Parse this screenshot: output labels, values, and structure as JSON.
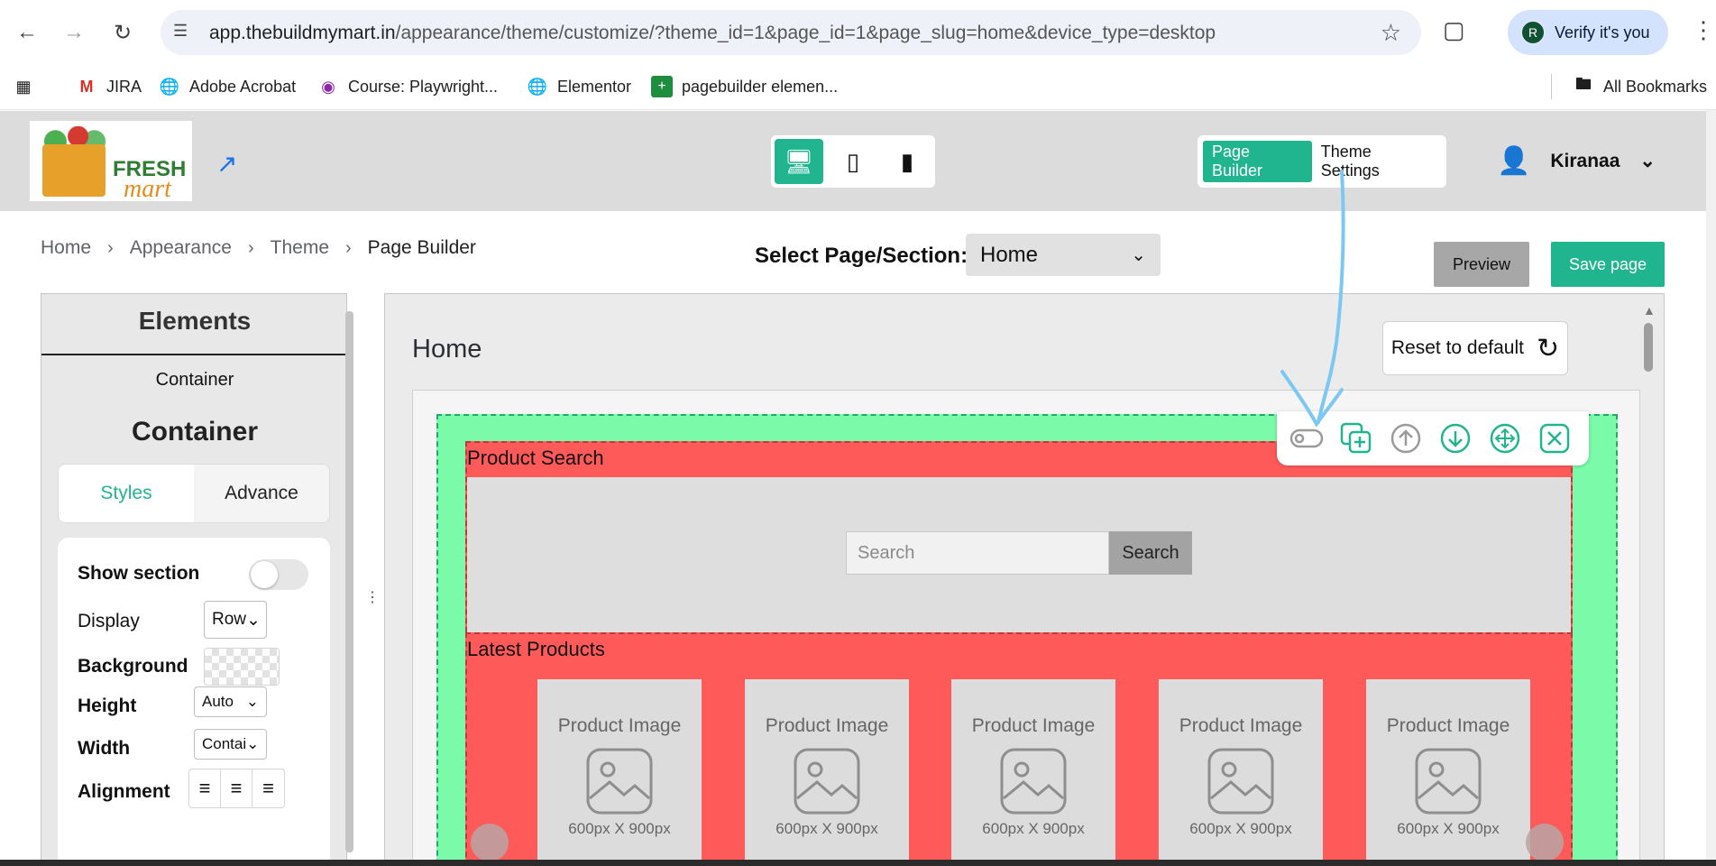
{
  "browser": {
    "url_host": "app.thebuildmymart.in",
    "url_path": "/appearance/theme/customize/?theme_id=1&page_id=1&page_slug=home&device_type=desktop",
    "verify_label": "Verify it's you",
    "avatar_letter": "R",
    "bookmarks": [
      "JIRA",
      "Adobe Acrobat",
      "Course: Playwright...",
      "Elementor",
      "pagebuilder elemen..."
    ],
    "all_bookmarks": "All Bookmarks"
  },
  "header": {
    "logo_word1": "FRESH",
    "logo_word2": "mart",
    "modes": [
      "Page Builder",
      "Theme Settings"
    ],
    "active_mode": "Page Builder",
    "active_device": "desktop",
    "user_name": "Kiranaa"
  },
  "breadcrumb": [
    "Home",
    "Appearance",
    "Theme",
    "Page Builder"
  ],
  "page_select": {
    "label": "Select Page/Section:",
    "value": "Home"
  },
  "actions": {
    "preview": "Preview",
    "save": "Save page"
  },
  "left_panel": {
    "title": "Elements",
    "subtitle": "Container",
    "heading": "Container",
    "tabs": [
      "Styles",
      "Advance"
    ],
    "active_tab": "Styles",
    "props": {
      "show_section": "Show section",
      "display": "Display",
      "display_value": "Row",
      "background": "Background",
      "height": "Height",
      "height_value": "Auto",
      "width": "Width",
      "width_value": "Contai",
      "alignment": "Alignment"
    },
    "show_section_on": false
  },
  "canvas": {
    "title": "Home",
    "reset_label": "Reset to default",
    "sections": [
      {
        "label": "Product Search",
        "search_placeholder": "Search",
        "search_button": "Search"
      },
      {
        "label": "Latest Products",
        "products": [
          {
            "title": "Product Image",
            "dims": "600px X 900px"
          },
          {
            "title": "Product Image",
            "dims": "600px X 900px"
          },
          {
            "title": "Product Image",
            "dims": "600px X 900px"
          },
          {
            "title": "Product Image",
            "dims": "600px X 900px"
          },
          {
            "title": "Product Image",
            "dims": "600px X 900px"
          }
        ]
      }
    ],
    "toolbar_icons": [
      "toggle-visibility-icon",
      "duplicate-icon",
      "move-up-icon",
      "move-down-icon",
      "drag-move-icon",
      "delete-icon"
    ]
  },
  "colors": {
    "accent": "#21b58f",
    "container_bg": "#7bfaaa",
    "section_bg": "#ff5a5a",
    "annotation": "#7cc8f5"
  }
}
